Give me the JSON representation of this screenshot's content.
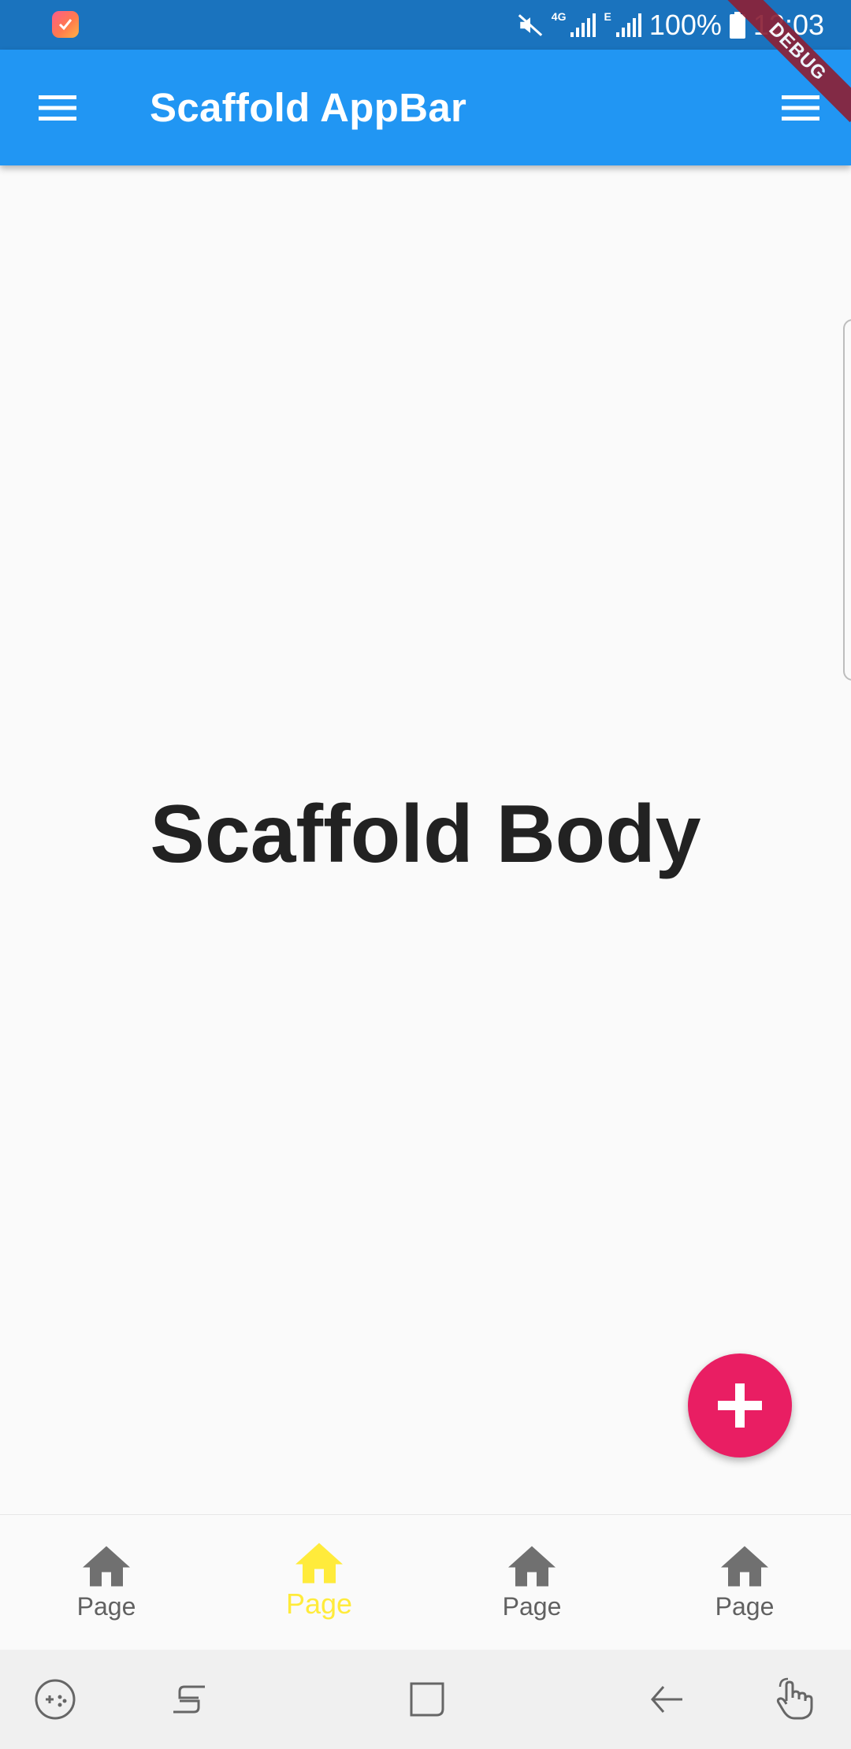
{
  "status_bar": {
    "network": "4G",
    "network_2": "E",
    "battery": "100%",
    "time": "12:03"
  },
  "app_bar": {
    "title": "Scaffold AppBar",
    "debug_banner": "DEBUG"
  },
  "body": {
    "text": "Scaffold Body"
  },
  "fab": {
    "icon": "plus-icon",
    "color": "#e91e63"
  },
  "bottom_nav": {
    "items": [
      {
        "label": "Page",
        "icon": "home-icon",
        "active": false
      },
      {
        "label": "Page",
        "icon": "home-icon",
        "active": true
      },
      {
        "label": "Page",
        "icon": "home-icon",
        "active": false
      },
      {
        "label": "Page",
        "icon": "home-icon",
        "active": false
      }
    ],
    "active_color": "#ffeb3b",
    "inactive_color": "#616161"
  },
  "colors": {
    "app_bar": "#2196f3",
    "status_bar": "#1a73be"
  }
}
